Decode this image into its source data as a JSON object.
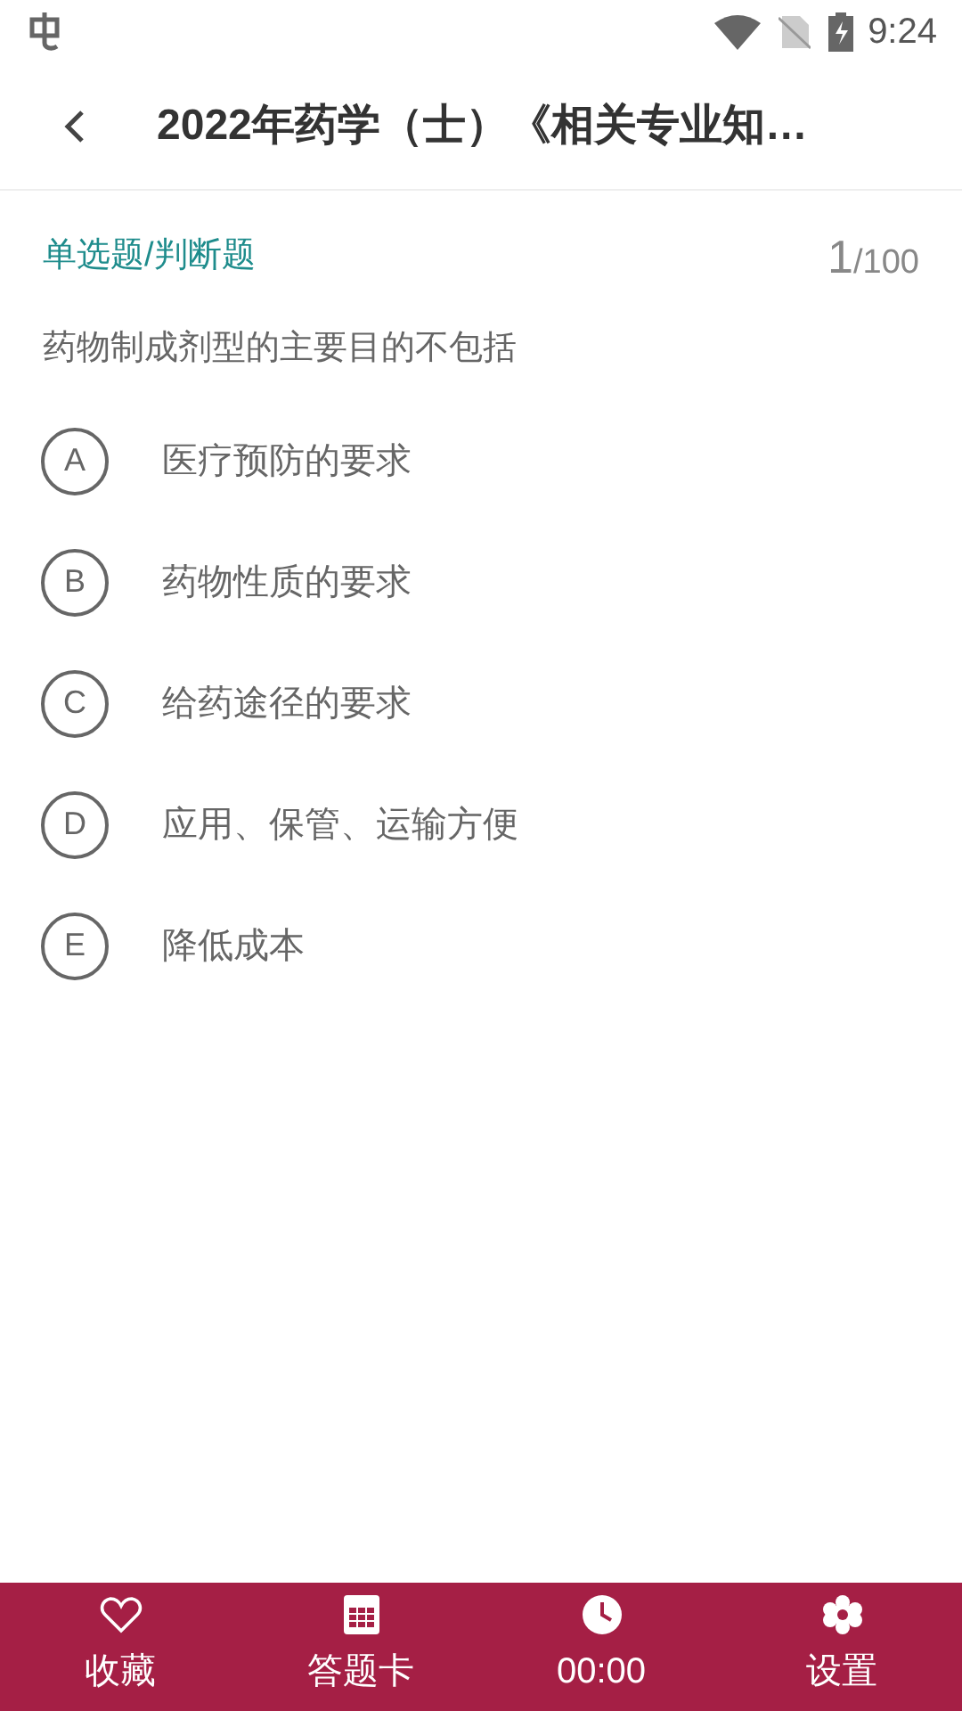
{
  "status_bar": {
    "time": "9:24"
  },
  "header": {
    "title": "2022年药学（士）《相关专业知…"
  },
  "question": {
    "type": "单选题/判断题",
    "number": "1",
    "total": "/100",
    "text": "药物制成剂型的主要目的不包括",
    "options": [
      {
        "letter": "A",
        "text": "医疗预防的要求"
      },
      {
        "letter": "B",
        "text": "药物性质的要求"
      },
      {
        "letter": "C",
        "text": "给药途径的要求"
      },
      {
        "letter": "D",
        "text": "应用、保管、运输方便"
      },
      {
        "letter": "E",
        "text": "降低成本"
      }
    ]
  },
  "bottom_bar": [
    {
      "kind": "heart",
      "label": "收藏"
    },
    {
      "kind": "grid",
      "label": "答题卡"
    },
    {
      "kind": "clock",
      "label": "00:00"
    },
    {
      "kind": "gear",
      "label": "设置"
    }
  ]
}
